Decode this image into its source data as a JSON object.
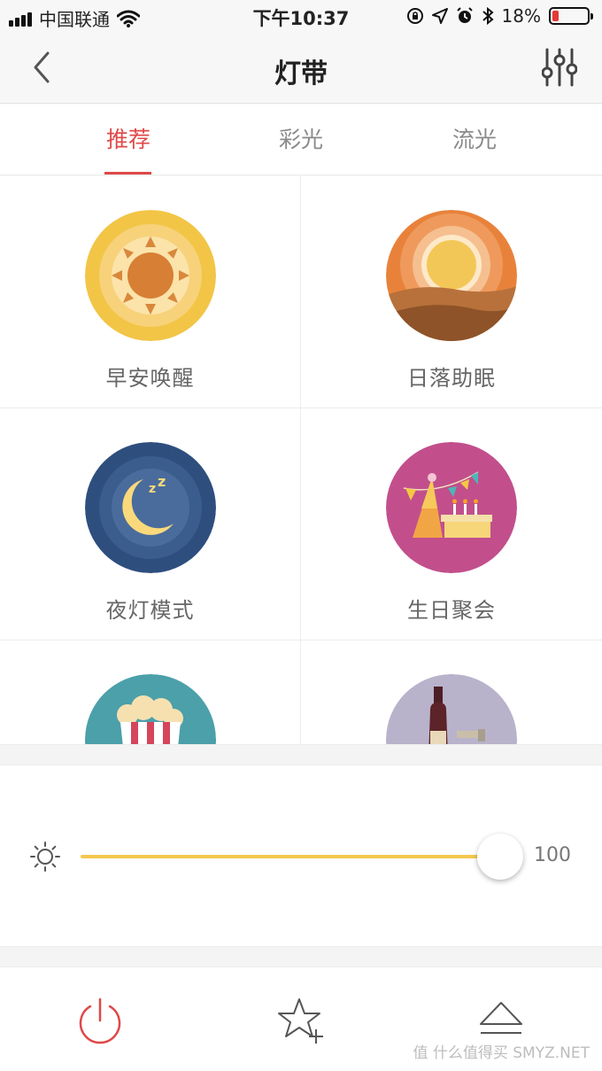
{
  "status_bar": {
    "carrier": "中国联通",
    "time": "下午10:37",
    "battery": "18%",
    "battery_level": 0.18,
    "icons": [
      "signal-icon",
      "wifi-icon",
      "orientation-lock-icon",
      "location-icon",
      "alarm-icon",
      "bluetooth-icon",
      "battery-icon"
    ]
  },
  "nav": {
    "title": "灯带",
    "back_icon": "chevron-left-icon",
    "settings_icon": "sliders-icon"
  },
  "tabs": [
    {
      "label": "推荐",
      "active": true
    },
    {
      "label": "彩光",
      "active": false
    },
    {
      "label": "流光",
      "active": false
    }
  ],
  "scenes": [
    {
      "label": "早安唤醒",
      "icon": "sunrise-icon"
    },
    {
      "label": "日落助眠",
      "icon": "sunset-icon"
    },
    {
      "label": "夜灯模式",
      "icon": "moon-icon"
    },
    {
      "label": "生日聚会",
      "icon": "party-icon"
    },
    {
      "label": "",
      "icon": "popcorn-icon"
    },
    {
      "label": "",
      "icon": "wine-icon"
    }
  ],
  "brightness": {
    "value": "100",
    "level": 1.0,
    "icon": "sun-icon"
  },
  "bottom_bar": {
    "icons": [
      "power-icon",
      "star-add-icon",
      "eject-icon"
    ]
  },
  "watermark": "值 什么值得买 SMYZ.NET",
  "colors": {
    "accent": "#e04848",
    "slider": "#f3c84e"
  }
}
